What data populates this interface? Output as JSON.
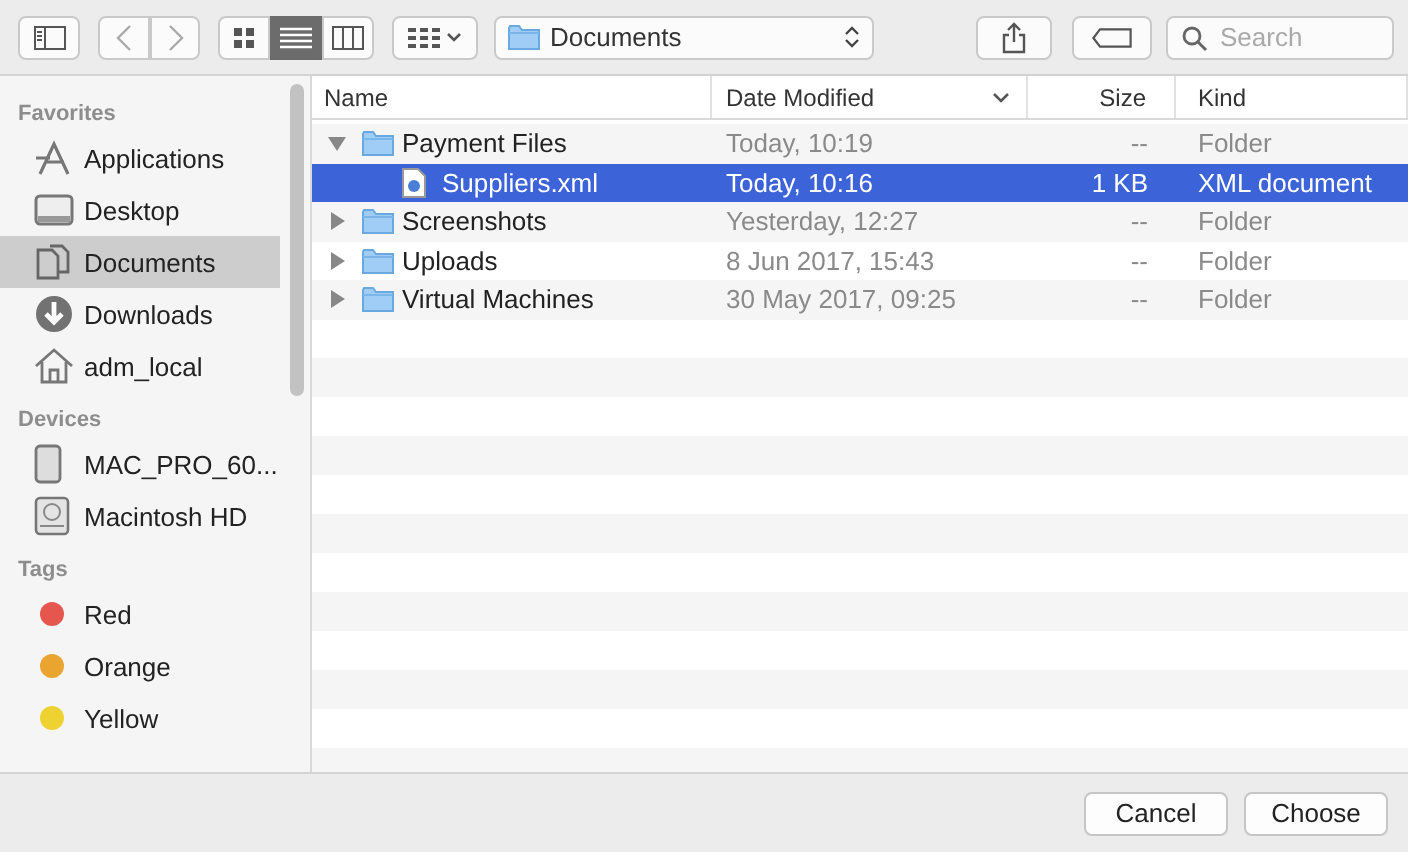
{
  "toolbar": {
    "view_modes": [
      {
        "kind": "icons",
        "selected": false
      },
      {
        "kind": "list",
        "selected": true
      },
      {
        "kind": "columns",
        "selected": false
      }
    ],
    "location": {
      "label": "Documents"
    },
    "search": {
      "placeholder": "Search"
    }
  },
  "sidebar": {
    "sections": [
      {
        "title": "Favorites",
        "items": [
          {
            "label": "Applications",
            "kind": "apps",
            "selected": false
          },
          {
            "label": "Desktop",
            "kind": "desktop",
            "selected": false
          },
          {
            "label": "Documents",
            "kind": "documents",
            "selected": true
          },
          {
            "label": "Downloads",
            "kind": "downloads",
            "selected": false
          },
          {
            "label": "adm_local",
            "kind": "home",
            "selected": false
          }
        ]
      },
      {
        "title": "Devices",
        "items": [
          {
            "label": "MAC_PRO_60...",
            "kind": "drive",
            "selected": false
          },
          {
            "label": "Macintosh HD",
            "kind": "disk",
            "selected": false
          }
        ]
      },
      {
        "title": "Tags",
        "items": [
          {
            "label": "Red",
            "kind": "tag",
            "color": "#e5574e",
            "selected": false
          },
          {
            "label": "Orange",
            "kind": "tag",
            "color": "#eaa531",
            "selected": false
          },
          {
            "label": "Yellow",
            "kind": "tag",
            "color": "#eed231",
            "selected": false
          }
        ]
      }
    ]
  },
  "table": {
    "columns": [
      {
        "label": "Name",
        "sorted": false
      },
      {
        "label": "Date Modified",
        "sorted": true
      },
      {
        "label": "Size",
        "sorted": false
      },
      {
        "label": "Kind",
        "sorted": false
      }
    ],
    "rows": [
      {
        "name": "Payment Files",
        "kind": "folder",
        "date": "Today, 10:19",
        "size": "--",
        "type": "Folder",
        "expanded": true,
        "selected": false,
        "children": [
          {
            "name": "Suppliers.xml",
            "kind": "xml",
            "date": "Today, 10:16",
            "size": "1 KB",
            "type": "XML document",
            "selected": true
          }
        ]
      },
      {
        "name": "Screenshots",
        "kind": "folder",
        "date": "Yesterday, 12:27",
        "size": "--",
        "type": "Folder",
        "expanded": false,
        "selected": false
      },
      {
        "name": "Uploads",
        "kind": "folder",
        "date": "8 Jun 2017, 15:43",
        "size": "--",
        "type": "Folder",
        "expanded": false,
        "selected": false
      },
      {
        "name": "Virtual Machines",
        "kind": "folder",
        "date": "30 May 2017, 09:25",
        "size": "--",
        "type": "Folder",
        "expanded": false,
        "selected": false
      }
    ]
  },
  "buttons": [
    {
      "label": "Cancel"
    },
    {
      "label": "Choose"
    }
  ]
}
